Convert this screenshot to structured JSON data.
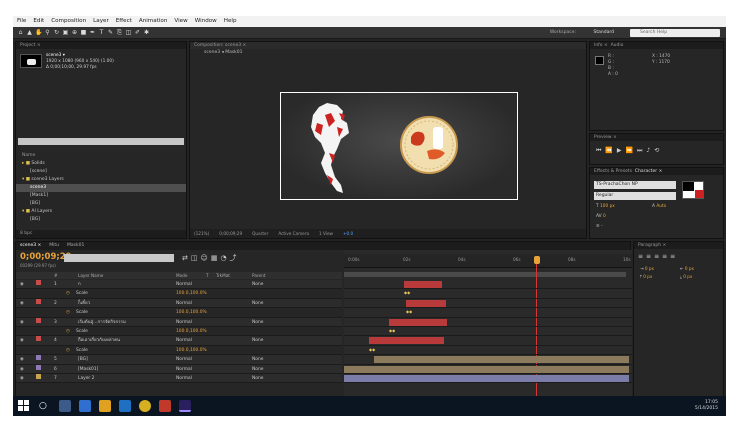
{
  "menu": [
    "File",
    "Edit",
    "Composition",
    "Layer",
    "Effect",
    "Animation",
    "View",
    "Window",
    "Help"
  ],
  "toolbar": {
    "workspace_label": "Workspace:",
    "workspace_value": "Standard",
    "search_placeholder": "Search Help"
  },
  "project": {
    "tab": "Project  ×",
    "item_name": "scene3 ▾",
    "item_info1": "1920 x 1080 (960 x 540) (1.00)",
    "item_info2": "Δ 0;00;10;00, 29.97 fps",
    "column": "Name",
    "items": [
      "Solids",
      "[scene]",
      "scene3 Layers",
      "scene3",
      "[Mask1]",
      "[BG]",
      "AI Layers",
      "[BG]"
    ],
    "footer": "8 bpc"
  },
  "viewer": {
    "tab": "Composition: scene3  ×",
    "breadcrumb": "scene3  ◂  Mask01",
    "zoom": "(121%)",
    "timecode": "0;00;09;29",
    "quality": "Quarter",
    "camera": "Active Camera",
    "views": "1 View",
    "offset": "+0.0"
  },
  "info": {
    "tab": "Info  ×",
    "tab2": "Audio",
    "r": "R :",
    "g": "G :",
    "b": "B :",
    "a": "A : 0",
    "x": "X : 1470",
    "y": "Y : 1170"
  },
  "preview": {
    "tab": "Preview  ×"
  },
  "character": {
    "tab": "Effects & Presets",
    "tab2": "Character  ×",
    "font": "TS-PrachaChon NP",
    "style": "Regular",
    "size": "100 px",
    "leading": "Auto",
    "tracking": "0",
    "stroke": "-"
  },
  "timeline": {
    "tabs": [
      "scene3  ×",
      "Mitu",
      "Mask01"
    ],
    "timecode": "0;00;09;29",
    "frames": "00299 (29.97 fps)",
    "columns": [
      "#",
      "Layer Name",
      "Mode",
      "T",
      "TrkMat",
      "Parent"
    ],
    "ruler": [
      "0:00s",
      "02s",
      "04s",
      "06s",
      "08s",
      "10s"
    ],
    "footer": "Toggle Switches / Modes",
    "layers": [
      {
        "num": "1",
        "name": "ก",
        "mode": "Normal",
        "parent": "None",
        "type": "layer",
        "color": "#c84c4c"
      },
      {
        "num": "",
        "name": "Scale",
        "value": "100.0,100.0%",
        "type": "sub"
      },
      {
        "num": "2",
        "name": "ก็เดี๋ยว",
        "mode": "Normal",
        "parent": "None",
        "type": "layer",
        "color": "#c84c4c"
      },
      {
        "num": "",
        "name": "Scale",
        "value": "100.0,100.0%",
        "type": "sub"
      },
      {
        "num": "3",
        "name": "เริ่มต้นสู่...การจัดกิจกรรม",
        "mode": "Normal",
        "parent": "None",
        "type": "layer",
        "color": "#c84c4c"
      },
      {
        "num": "",
        "name": "Scale",
        "value": "100.0,100.0%",
        "type": "sub"
      },
      {
        "num": "4",
        "name": "ถือเอาเกี่ยวกับเหล่าคน",
        "mode": "Normal",
        "parent": "None",
        "type": "layer",
        "color": "#c84c4c"
      },
      {
        "num": "",
        "name": "Scale",
        "value": "100.0,100.0%",
        "type": "sub"
      },
      {
        "num": "5",
        "name": "[BG]",
        "mode": "Normal",
        "parent": "None",
        "type": "layer",
        "color": "#8d7ab5"
      },
      {
        "num": "6",
        "name": "[Mask01]",
        "mode": "Normal",
        "parent": "None",
        "type": "layer",
        "color": "#8d7ab5"
      },
      {
        "num": "7",
        "name": "Layer 2",
        "mode": "Normal",
        "parent": "None",
        "type": "layer",
        "color": "#c8a44c"
      }
    ]
  },
  "paragraph": {
    "tab": "Paragraph  ×",
    "indent_left": "0 px",
    "indent_right": "0 px",
    "first_line": "0 px",
    "space_before": "0 px",
    "space_after": "0 px"
  },
  "taskbar": {
    "time": "17:05",
    "date": "5/14/2015"
  }
}
